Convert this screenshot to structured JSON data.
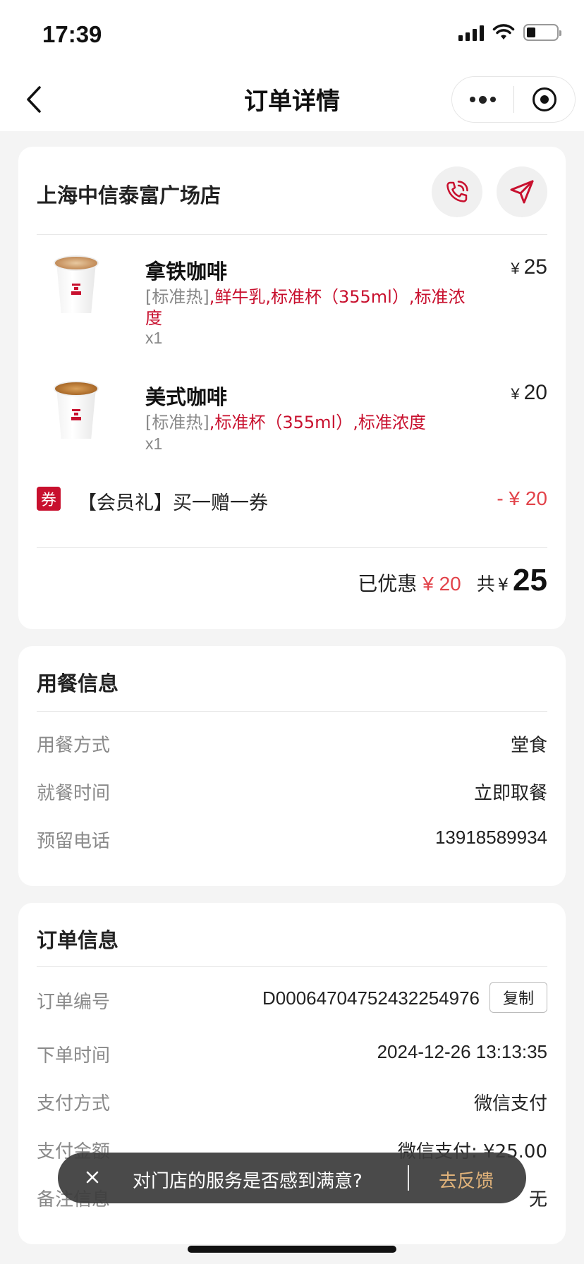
{
  "status_bar": {
    "time": "17:39"
  },
  "nav": {
    "title": "订单详情"
  },
  "store": {
    "name": "上海中信泰富广场店"
  },
  "items": [
    {
      "name": "拿铁咖啡",
      "price": "25",
      "spec_default": "[标准热]",
      "spec_options_line1": ",鲜牛乳,标准杯（355ml）,标准浓",
      "spec_options_line2": "度",
      "qty": "x1"
    },
    {
      "name": "美式咖啡",
      "price": "20",
      "spec_default": "[标准热]",
      "spec_options_line1": ",标准杯（355ml）,标准浓度",
      "qty": "x1"
    }
  ],
  "currency": "¥",
  "coupon": {
    "tag": "券",
    "name": "【会员礼】买一赠一券",
    "amount": "- ¥ 20"
  },
  "summary": {
    "saved_label": "已优惠",
    "saved_value": "¥ 20",
    "total_label": "共",
    "total_yen": "¥",
    "total_value": "25"
  },
  "dining_info": {
    "title": "用餐信息",
    "rows": [
      {
        "label": "用餐方式",
        "value": "堂食"
      },
      {
        "label": "就餐时间",
        "value": "立即取餐"
      },
      {
        "label": "预留电话",
        "value": "13918589934"
      }
    ]
  },
  "order_info": {
    "title": "订单信息",
    "copy_label": "复制",
    "rows": [
      {
        "label": "订单编号",
        "value": "D00064704752432254976"
      },
      {
        "label": "下单时间",
        "value": "2024-12-26 13:13:35"
      },
      {
        "label": "支付方式",
        "value": "微信支付"
      },
      {
        "label": "支付金额",
        "value": "微信支付: ¥25.00"
      },
      {
        "label": "备注信息",
        "value": "无"
      }
    ]
  },
  "toast": {
    "text": "对门店的服务是否感到满意?",
    "action": "去反馈"
  },
  "colors": {
    "brand_red": "#c8102e",
    "discount_red": "#e2434a",
    "toast_action": "#e0b27a"
  }
}
